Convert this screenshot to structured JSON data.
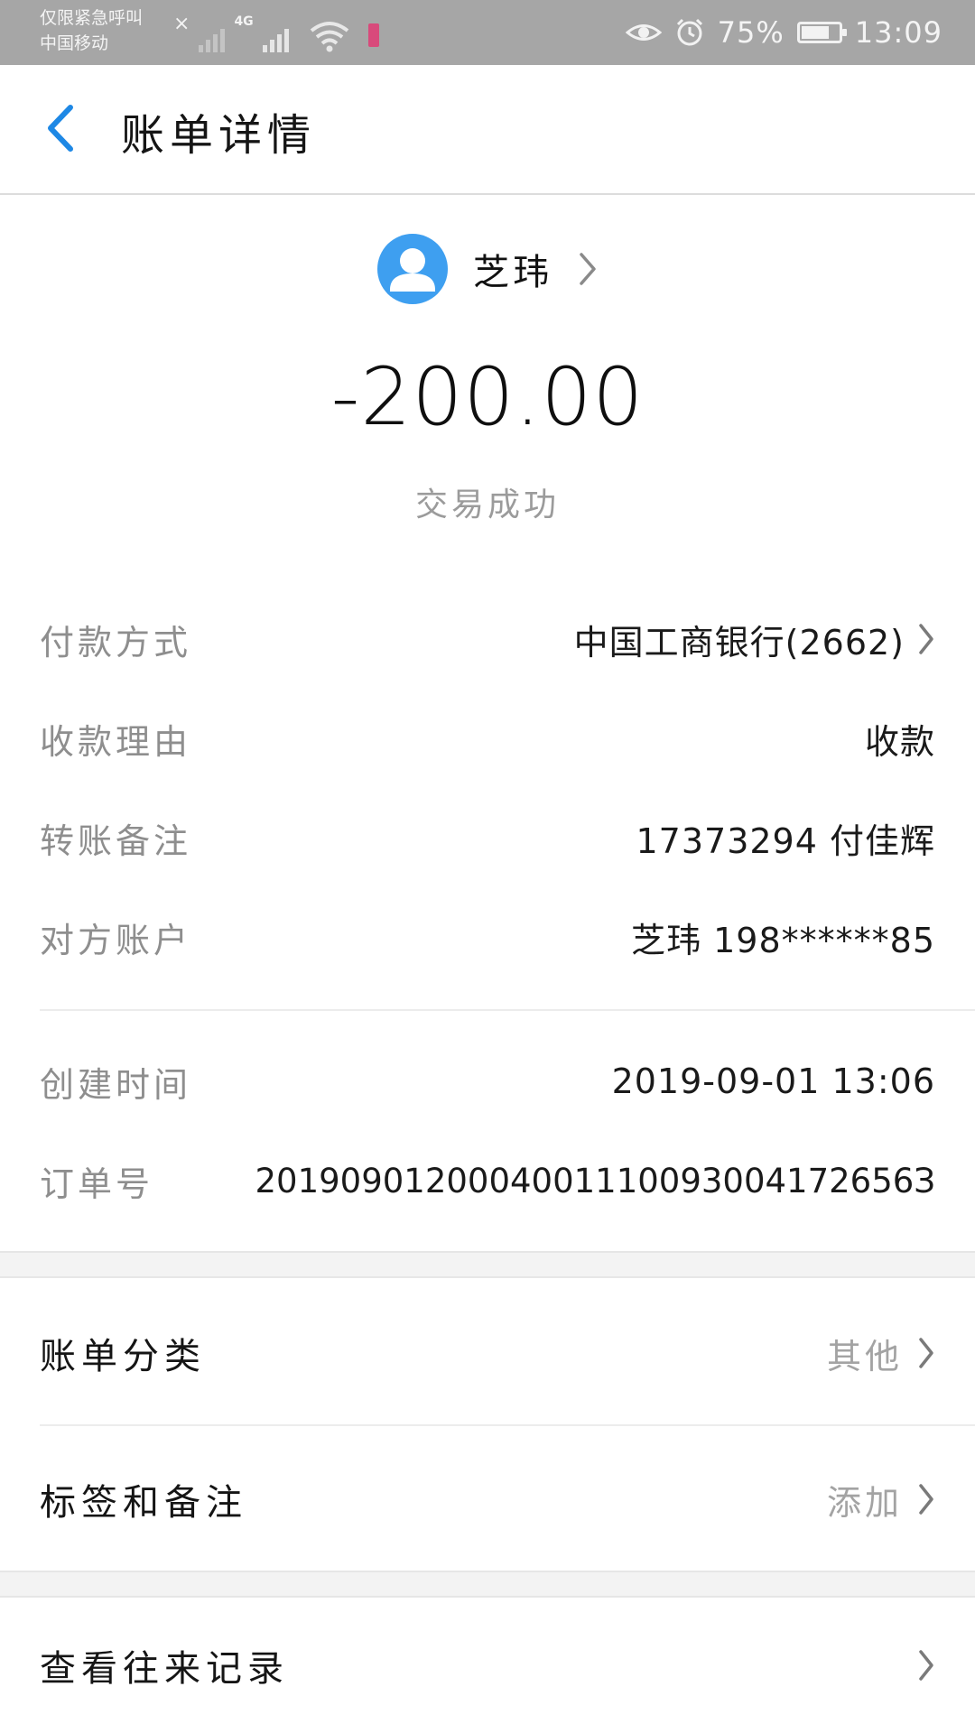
{
  "status_bar": {
    "carrier_line1": "仅限紧急呼叫",
    "carrier_line2": "中国移动",
    "network": "4G",
    "battery_percent": "75%",
    "battery_level": 0.75,
    "time": "13:09"
  },
  "header": {
    "title": "账单详情",
    "back_icon": "chevron-left-icon",
    "accent_color": "#1e88e5"
  },
  "summary": {
    "payee_name": "芝玮",
    "amount": "-200.00",
    "status": "交易成功",
    "avatar_color": "#3e9ff0"
  },
  "details": [
    {
      "label": "付款方式",
      "value": "中国工商银行(2662)",
      "has_chevron": true
    },
    {
      "label": "收款理由",
      "value": "收款",
      "has_chevron": false
    },
    {
      "label": "转账备注",
      "value": "17373294 付佳辉",
      "has_chevron": false
    },
    {
      "label": "对方账户",
      "value": "芝玮 198******85",
      "has_chevron": false
    }
  ],
  "meta": [
    {
      "label": "创建时间",
      "value": "2019-09-01 13:06"
    },
    {
      "label": "订单号",
      "value": "2019090120004001110093004172656З"
    }
  ],
  "actions": {
    "category": {
      "label": "账单分类",
      "value": "其他"
    },
    "tags": {
      "label": "标签和备注",
      "value": "添加"
    },
    "history": {
      "label": "查看往来记录"
    }
  }
}
